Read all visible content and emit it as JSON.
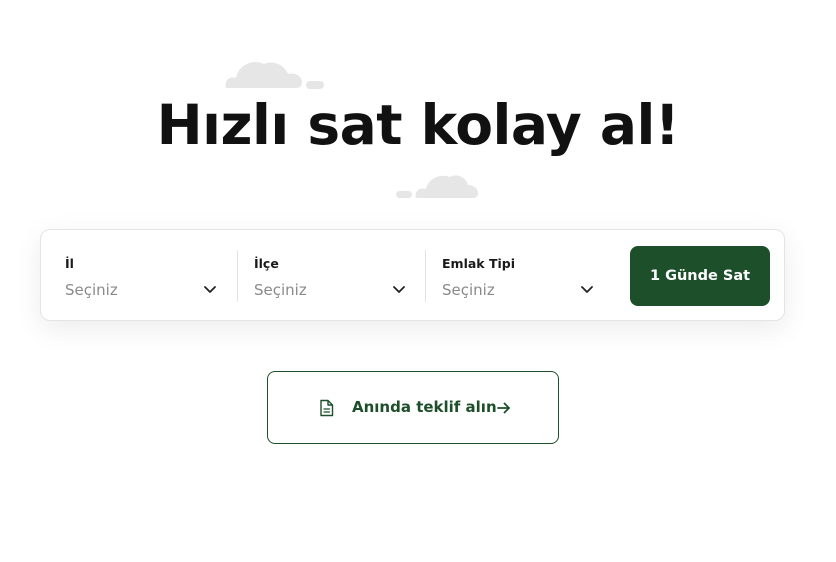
{
  "hero": {
    "title": "Hızlı sat kolay al!"
  },
  "search_form": {
    "fields": [
      {
        "label": "İl",
        "value": "Seçiniz"
      },
      {
        "label": "İlçe",
        "value": "Seçiniz"
      },
      {
        "label": "Emlak Tipi",
        "value": "Seçiniz"
      }
    ],
    "submit_label": "1 Günde Sat"
  },
  "offer": {
    "label": "Anında teklif alın",
    "icon": "document-icon",
    "trailing_icon": "arrow-right-icon"
  },
  "colors": {
    "brand": "#1d4f2a",
    "cloud": "#e6e6e6",
    "text": "#111111",
    "placeholder": "#8a8a8a"
  }
}
